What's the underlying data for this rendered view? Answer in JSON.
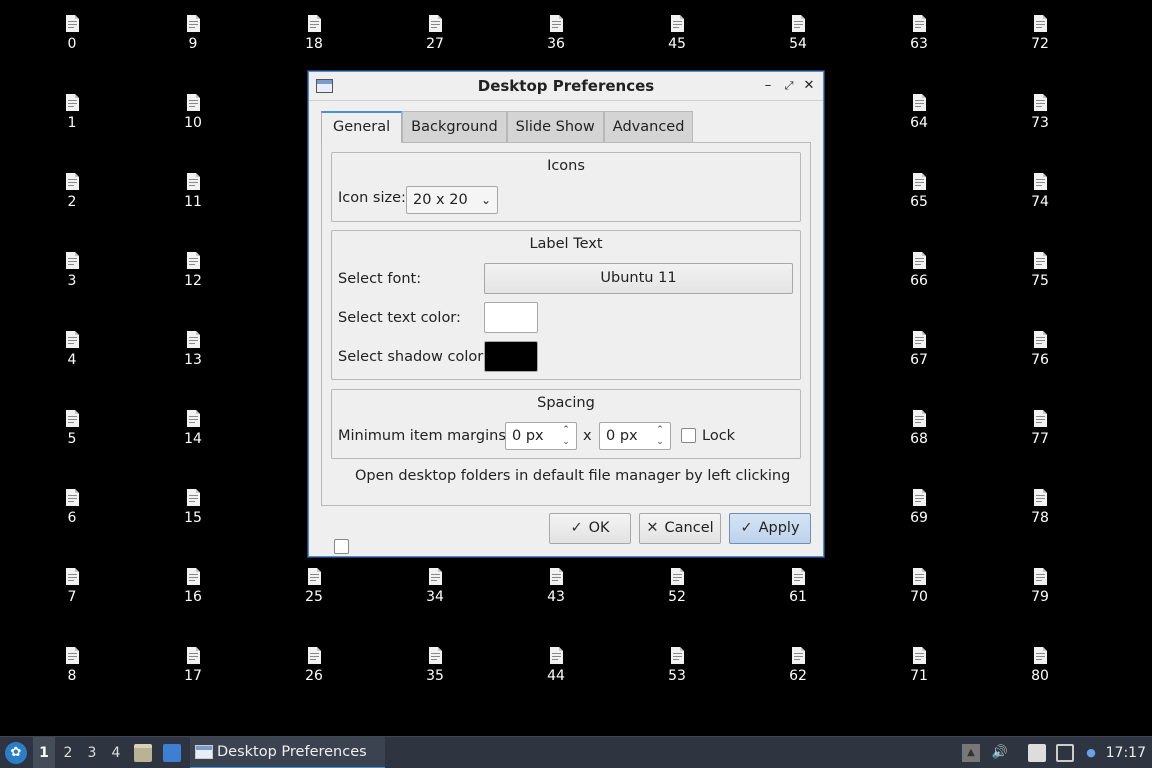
{
  "desktop": {
    "icons": [
      "0",
      "1",
      "2",
      "3",
      "4",
      "5",
      "6",
      "7",
      "8",
      "9",
      "10",
      "11",
      "12",
      "13",
      "14",
      "15",
      "16",
      "17",
      "18",
      "25",
      "26",
      "27",
      "34",
      "35",
      "36",
      "43",
      "44",
      "45",
      "52",
      "53",
      "54",
      "61",
      "62",
      "63",
      "64",
      "65",
      "66",
      "67",
      "68",
      "69",
      "70",
      "71",
      "72",
      "73",
      "74",
      "75",
      "76",
      "77",
      "78",
      "79",
      "80"
    ]
  },
  "dialog": {
    "title": "Desktop Preferences",
    "tabs": [
      "General",
      "Background",
      "Slide Show",
      "Advanced"
    ],
    "icons_group": {
      "title": "Icons",
      "icon_size_label": "Icon size:",
      "icon_size_value": "20 x 20"
    },
    "label_group": {
      "title": "Label Text",
      "font_label": "Select font:",
      "font_value": "Ubuntu 11",
      "text_color_label": "Select text color:",
      "text_color": "#ffffff",
      "shadow_color_label": "Select shadow color:",
      "shadow_color": "#000000"
    },
    "spacing_group": {
      "title": "Spacing",
      "margins_label": "Minimum item margins:",
      "margin_x": "0 px",
      "separator": "x",
      "margin_y": "0 px",
      "lock_label": "Lock",
      "lock_checked": false
    },
    "open_folders_label": "Open desktop folders in default file manager by left clicking",
    "open_folders_checked": false,
    "buttons": {
      "ok": "OK",
      "cancel": "Cancel",
      "apply": "Apply"
    }
  },
  "taskbar": {
    "workspaces": [
      "1",
      "2",
      "3",
      "4"
    ],
    "active_workspace": "1",
    "task_title": "Desktop Preferences",
    "clock": "17:17",
    "accent": "#4a90d9"
  }
}
